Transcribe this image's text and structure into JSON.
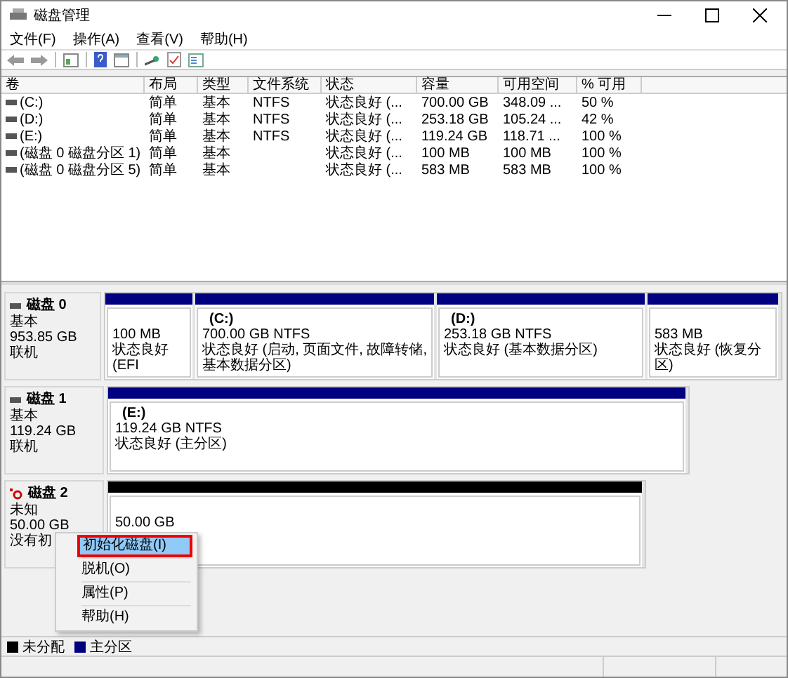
{
  "window": {
    "title": "磁盘管理"
  },
  "menu": [
    "文件(F)",
    "操作(A)",
    "查看(V)",
    "帮助(H)"
  ],
  "volumes": {
    "columns": [
      "卷",
      "布局",
      "类型",
      "文件系统",
      "状态",
      "容量",
      "可用空间",
      "% 可用"
    ],
    "rows": [
      {
        "cells": [
          "(C:)",
          "简单",
          "基本",
          "NTFS",
          "状态良好 (...",
          "700.00 GB",
          "348.09 ...",
          "50 %"
        ]
      },
      {
        "cells": [
          "(D:)",
          "简单",
          "基本",
          "NTFS",
          "状态良好 (...",
          "253.18 GB",
          "105.24 ...",
          "42 %"
        ]
      },
      {
        "cells": [
          "(E:)",
          "简单",
          "基本",
          "NTFS",
          "状态良好 (...",
          "119.24 GB",
          "118.71 ...",
          "100 %"
        ]
      },
      {
        "cells": [
          "(磁盘 0 磁盘分区 1)",
          "简单",
          "基本",
          "",
          "状态良好 (...",
          "100 MB",
          "100 MB",
          "100 %"
        ]
      },
      {
        "cells": [
          "(磁盘 0 磁盘分区 5)",
          "简单",
          "基本",
          "",
          "状态良好 (...",
          "583 MB",
          "583 MB",
          "100 %"
        ]
      }
    ]
  },
  "disks": [
    {
      "name": "磁盘 0",
      "initialized": true,
      "type": "基本",
      "size": "953.85 GB",
      "status": "联机",
      "partitions": [
        {
          "kind": "primary",
          "size": "100 MB",
          "status": "状态良好 (EFI"
        },
        {
          "kind": "primary",
          "label": "(C:)",
          "size": "700.00 GB NTFS",
          "status": "状态良好 (启动, 页面文件, 故障转储, 基本数据分区)"
        },
        {
          "kind": "primary",
          "label": "(D:)",
          "size": "253.18 GB NTFS",
          "status": "状态良好 (基本数据分区)"
        },
        {
          "kind": "primary",
          "size": "583 MB",
          "status": "状态良好 (恢复分区)"
        }
      ]
    },
    {
      "name": "磁盘 1",
      "initialized": true,
      "type": "基本",
      "size": "119.24 GB",
      "status": "联机",
      "partitions": [
        {
          "kind": "primary",
          "label": "(E:)",
          "size": "119.24 GB NTFS",
          "status": "状态良好 (主分区)"
        }
      ]
    },
    {
      "name": "磁盘 2",
      "initialized": false,
      "type": "未知",
      "size": "50.00 GB",
      "status": "没有初",
      "partitions": [
        {
          "kind": "unallocated",
          "size": "50.00 GB"
        }
      ]
    }
  ],
  "context_menu": [
    {
      "label": "初始化磁盘(I)",
      "selected": true,
      "annotated": true
    },
    {
      "label": "脱机(O)",
      "selected": false,
      "annotated": false
    },
    {
      "label": "属性(P)",
      "selected": false,
      "annotated": false
    },
    {
      "label": "帮助(H)",
      "selected": false,
      "annotated": false
    }
  ],
  "legend": [
    {
      "label": "未分配",
      "color": "#000000"
    },
    {
      "label": "主分区",
      "color": "#000080"
    }
  ]
}
